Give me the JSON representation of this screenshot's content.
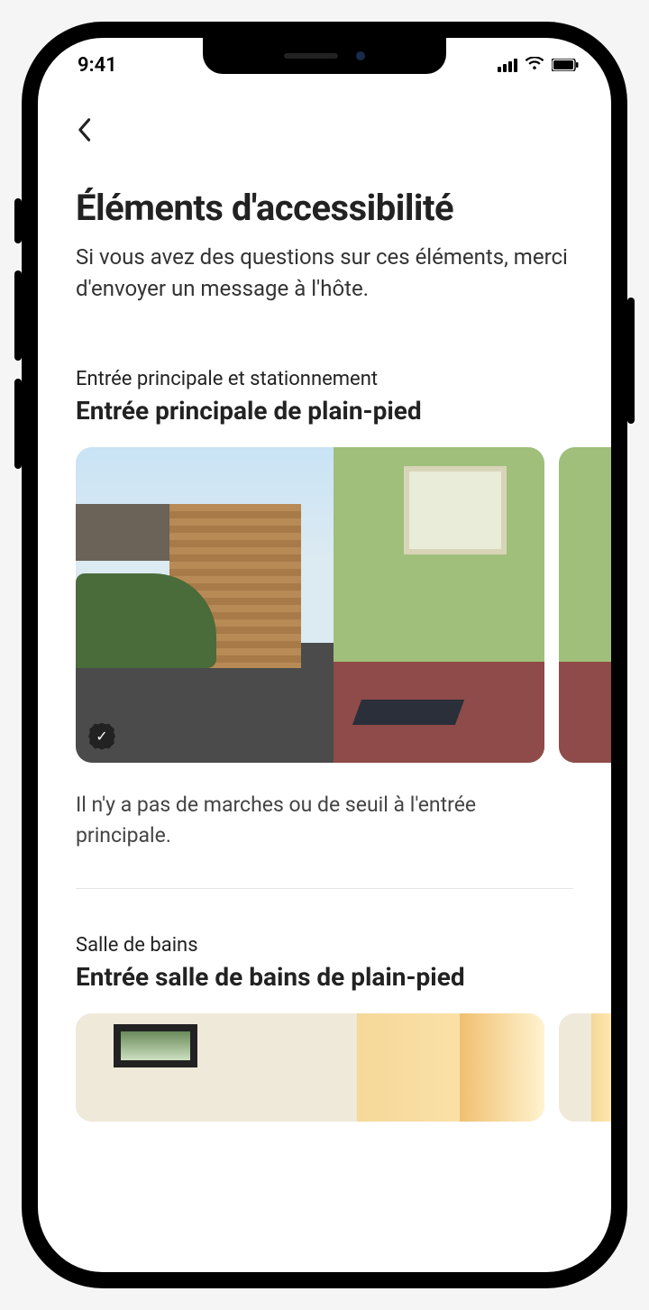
{
  "status": {
    "time": "9:41"
  },
  "header": {
    "title": "Éléments d'accessibilité",
    "subtitle": "Si vous avez des questions sur ces éléments, merci d'envoyer un message à l'hôte."
  },
  "sections": [
    {
      "category": "Entrée principale et stationnement",
      "title": "Entrée principale de plain-pied",
      "caption": "Il n'y a pas de marches ou de seuil à l'entrée principale."
    },
    {
      "category": "Salle de bains",
      "title": "Entrée salle de bains de plain-pied",
      "caption": ""
    }
  ]
}
